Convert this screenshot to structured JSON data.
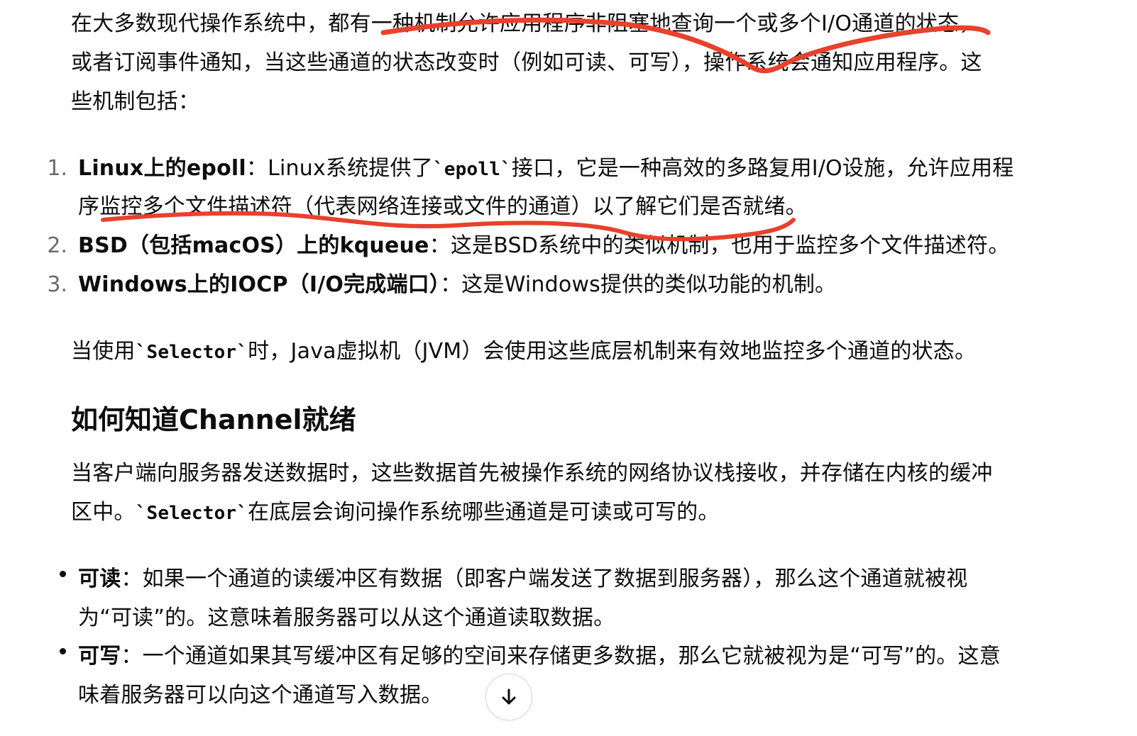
{
  "intro": {
    "line1": "在大多数现代操作系统中，都有一种机制允许应用程序非阻塞地查询一个或多个I/O通道的状态，",
    "line2": "或者订阅事件通知，当这些通道的状态改变时（例如可读、可写），操作系统会通知应用程序。这",
    "line3": "些机制包括："
  },
  "mechanisms": [
    {
      "number": "1.",
      "title": "Linux上的epoll",
      "sep": "：",
      "text_before": "Linux系统提供了",
      "code": "`epoll`",
      "text_after": "接口，它是一种高效的多路复用I/O设施，允许应用程",
      "line2": "序监控多个文件描述符（代表网络连接或文件的通道）以了解它们是否就绪。"
    },
    {
      "number": "2.",
      "title": "BSD（包括macOS）上的kqueue",
      "sep": "：",
      "text": "这是BSD系统中的类似机制，也用于监控多个文件描述符。"
    },
    {
      "number": "3.",
      "title": "Windows上的IOCP（I/O完成端口）",
      "sep": "：",
      "text": "这是Windows提供的类似功能的机制。"
    }
  ],
  "selector_para": {
    "before": "当使用",
    "code": "`Selector`",
    "after": "时，Java虚拟机（JVM）会使用这些底层机制来有效地监控多个通道的状态。"
  },
  "section": {
    "heading": "如何知道Channel就绪",
    "line1": "当客户端向服务器发送数据时，这些数据首先被操作系统的网络协议栈接收，并存储在内核的缓冲",
    "line2_before": "区中。",
    "line2_code": "`Selector`",
    "line2_after": "在底层会询问操作系统哪些通道是可读或可写的。"
  },
  "bullets": [
    {
      "title": "可读",
      "sep": "：",
      "line1": "如果一个通道的读缓冲区有数据（即客户端发送了数据到服务器），那么这个通道就被视",
      "line2": "为“可读”的。这意味着服务器可以从这个通道读取数据。"
    },
    {
      "title": "可写",
      "sep": "：",
      "line1": "一个通道如果其写缓冲区有足够的空间来存储更多数据，那么它就被视为是“可写”的。这意",
      "line2": "味着服务器可以向这个通道写入数据。"
    }
  ],
  "annotation_color": "#e8412c",
  "icons": {
    "scroll_down": "arrow-down-icon"
  }
}
